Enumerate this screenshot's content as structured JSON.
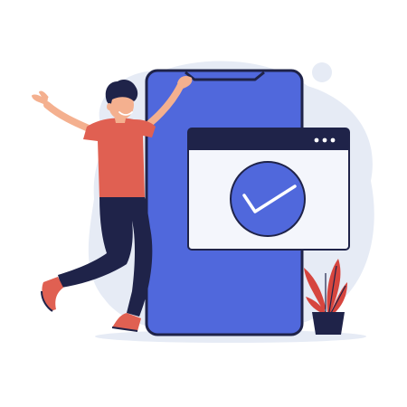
{
  "illustration": {
    "icons": {
      "check": "check-icon",
      "menu": "more-dots-icon",
      "plant": "potted-plant-icon",
      "phone": "smartphone-icon",
      "person": "celebrating-man-icon"
    },
    "colors": {
      "background_blob": "#E6EBF5",
      "phone_body": "#5068DC",
      "phone_outline": "#1F2349",
      "window_titlebar": "#1F2349",
      "window_body": "#F4F6FC",
      "check_circle": "#5068DC",
      "check_mark": "#FFFFFF",
      "shirt": "#E06052",
      "pants": "#1F2349",
      "hair": "#1F2349",
      "skin": "#F4B08F",
      "plant_leaves": "#D6453E",
      "plant_pot": "#1F2349",
      "ground_shadow": "#E6EBF5"
    }
  }
}
